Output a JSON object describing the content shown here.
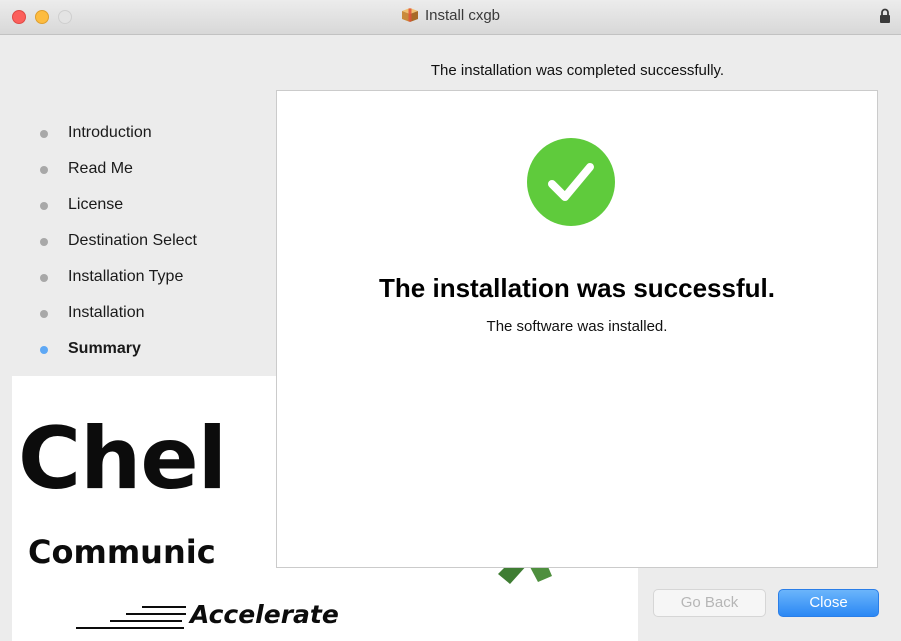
{
  "window": {
    "title": "Install cxgb"
  },
  "icons": {
    "title": "package-icon",
    "lock": "lock-icon",
    "success": "checkmark-icon"
  },
  "sidebar": {
    "steps": [
      {
        "label": "Introduction",
        "state": "done"
      },
      {
        "label": "Read Me",
        "state": "done"
      },
      {
        "label": "License",
        "state": "done"
      },
      {
        "label": "Destination Select",
        "state": "done"
      },
      {
        "label": "Installation Type",
        "state": "done"
      },
      {
        "label": "Installation",
        "state": "done"
      },
      {
        "label": "Summary",
        "state": "current"
      }
    ]
  },
  "logo": {
    "name": "Chel",
    "sub": "Communic",
    "tagline": "Accelerate"
  },
  "main": {
    "headline": "The installation was completed successfully.",
    "success_title": "The installation was successful.",
    "success_sub": "The software was installed."
  },
  "buttons": {
    "back": "Go Back",
    "close": "Close"
  },
  "colors": {
    "success_green": "#5fcb3c",
    "accent_blue": "#2b88f4",
    "active_step_dot": "#5ea8f5",
    "inactive_step_dot": "#a8a8a8"
  }
}
